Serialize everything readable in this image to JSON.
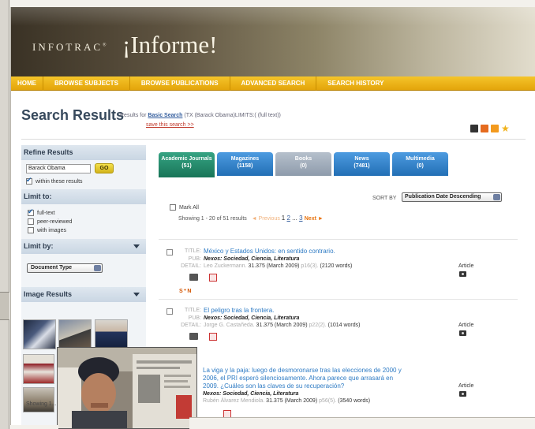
{
  "banner": {
    "brand_small": "INFOTRAC",
    "reg": "®",
    "brand_large": "¡Informe!"
  },
  "nav": [
    "HOME",
    "BROWSE SUBJECTS",
    "BROWSE PUBLICATIONS",
    "ADVANCED SEARCH",
    "SEARCH HISTORY"
  ],
  "page": {
    "title": "Search Results",
    "results_for_prefix": "Results for",
    "search_type": "Basic Search",
    "query": "(TX (Barack Obama)LIMITS:( (full text))",
    "save_link": "save this search >>"
  },
  "sidebar": {
    "refine_header": "Refine Results",
    "search_value": "Barack Obama",
    "go_label": "GO",
    "within_label": "within these results",
    "limit_to_header": "Limit to:",
    "limit_options": [
      {
        "label": "full-text",
        "checked": true
      },
      {
        "label": "peer-reviewed",
        "checked": false
      },
      {
        "label": "with images",
        "checked": false
      }
    ],
    "limit_by_header": "Limit by:",
    "document_type": "Document Type",
    "image_results_header": "Image Results",
    "showing_small": "Showing 1..."
  },
  "tabs": [
    {
      "label": "Academic Journals",
      "count": "(51)"
    },
    {
      "label": "Magazines",
      "count": "(1158)"
    },
    {
      "label": "Books",
      "count": "(0)"
    },
    {
      "label": "News",
      "count": "(7481)"
    },
    {
      "label": "Multimedia",
      "count": "(0)"
    }
  ],
  "list": {
    "mark_all": "Mark All",
    "showing": "Showing 1 - 20 of 51 results",
    "previous": "◄ Previous",
    "page1": "1",
    "page2": "2",
    "page3": "3",
    "next": "Next ►",
    "sort_by": "SORT BY",
    "sort_value": "Publication Date Descending"
  },
  "field_labels": {
    "title": "TITLE:",
    "pub": "PUB:",
    "detail": "DETAIL:"
  },
  "results": [
    {
      "title": "México y Estados Unidos: en sentido contrario.",
      "pub": "Nexos: Sociedad, Ciencia, Literatura",
      "author": "Leo Zuckermann.",
      "detail": "31.375 (March 2009)",
      "pages": "p16(3).",
      "words": "(2120 words)",
      "type": "Article"
    },
    {
      "title": "El peligro tras la frontera.",
      "pub": "Nexos: Sociedad, Ciencia, Literatura",
      "author": "Jorge G. Castañeda.",
      "detail": "31.375 (March 2009)",
      "pages": "p22(2).",
      "words": "(1014 words)",
      "type": "Article"
    },
    {
      "title": "La viga y la paja: luego de desmoronarse tras las elecciones de 2000 y 2006, el PRI esperó silenciosamente. Ahora parece que arrasará en 2009. ¿Cuáles son las claves de su recuperación?",
      "pub": "Nexos: Sociedad, Ciencia, Literatura",
      "author": "Rubén Álvarez Mendiola.",
      "detail": "31.375 (March 2009)",
      "pages": "p56(5).",
      "words": "(3540 words)",
      "type": "Article"
    }
  ],
  "social_label": "S⁺N",
  "colors": {
    "nav": "#e8ab12",
    "title": "#37495c",
    "link": "#2e7bc4",
    "tab_selected": "#187558",
    "tab_blue": "#226fb5"
  }
}
